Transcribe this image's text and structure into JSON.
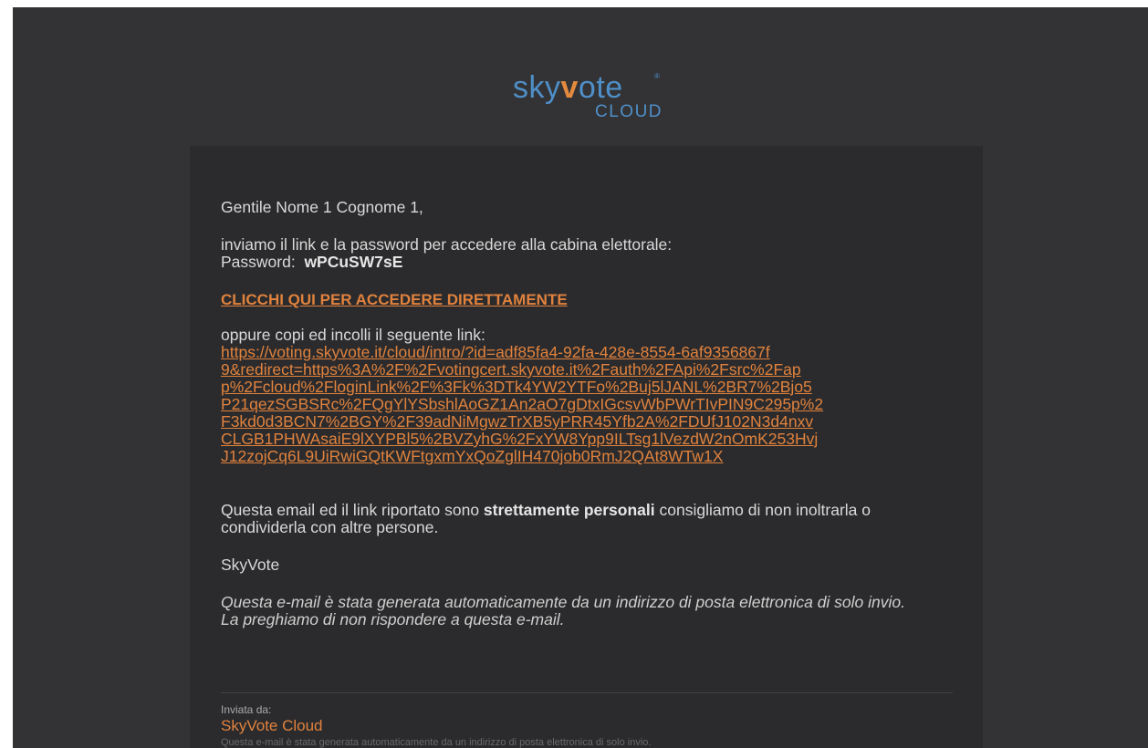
{
  "logo": {
    "text_pre": "sky",
    "text_v": "v",
    "text_post": "ote",
    "registered": "®",
    "subtitle": "CLOUD",
    "colors": {
      "blue": "#4f8fc8",
      "orange": "#e38a3f"
    }
  },
  "email": {
    "greeting": "Gentile Nome 1 Cognome 1,",
    "intro": "inviamo il link e la password per accedere alla cabina elettorale:",
    "password_label": "Password:",
    "password_value": "wPCuSW7sE",
    "direct_link": "CLICCHI QUI PER ACCEDERE DIRETTAMENTE",
    "copy_label": "oppure copi ed incolli il seguente link:",
    "url_lines": [
      "https://voting.skyvote.it/cloud/intro/?id=adf85fa4-92fa-428e-8554-6af9356867f",
      "9&redirect=https%3A%2F%2Fvotingcert.skyvote.it%2Fauth%2FApi%2Fsrc%2Fap",
      "p%2Fcloud%2FloginLink%2F%3Fk%3DTk4YW2YTFo%2Buj5lJANL%2BR7%2Bjo5",
      "P21qezSGBSRc%2FQgYlYSbshlAoGZ1An2aO7gDtxIGcsvWbPWrTIvPIN9C295p%2",
      "F3kd0d3BCN7%2BGY%2F39adNiMgwzTrXB5yPRR45Yfb2A%2FDUfJ102N3d4nxv",
      "CLGB1PHWAsaiE9lXYPBl5%2BVZyhG%2FxYW8Ypp9ILTsg1lVezdW2nOmK253Hvj",
      "J12zojCq6L9UiRwiGQtKWFtgxmYxQoZglIH470job0RmJ2QAt8WTw1X"
    ],
    "personal_pre": "Questa email ed il link riportato sono ",
    "personal_bold": "strettamente personali",
    "personal_post": " consigliamo di non inoltrarla o condividerla con altre persone.",
    "signature": "SkyVote",
    "auto_line1": "Questa e-mail è stata generata automaticamente da un indirizzo di posta elettronica di solo invio.",
    "auto_line2": "La preghiamo di non rispondere a questa e-mail."
  },
  "footer": {
    "sent_by_label": "Inviata da:",
    "sender": "SkyVote Cloud",
    "note": "Questa e-mail è stata generata automaticamente da un indirizzo di posta elettronica di solo invio."
  }
}
